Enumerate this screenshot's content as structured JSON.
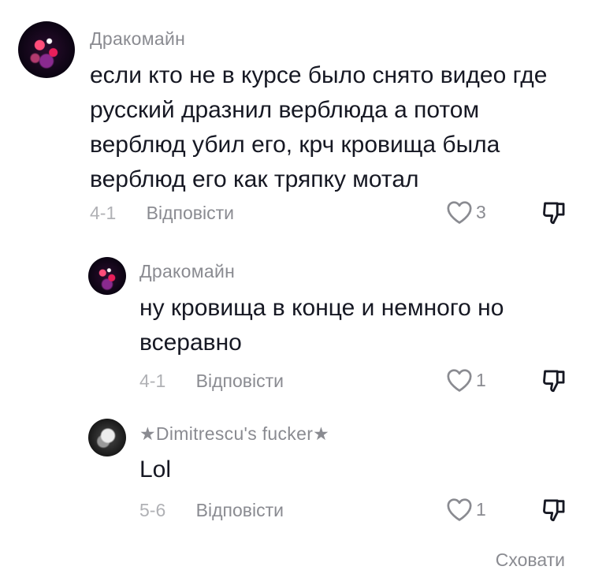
{
  "comments": [
    {
      "username": "Дракомайн",
      "text": "если кто не в курсе было снято видео где\nрусский дразнил верблюда а потом\nверблюд убил его, крч кровища была\nверблюд его как тряпку мотал",
      "date": "4-1",
      "reply_label": "Відповісти",
      "likes": "3",
      "avatar_icon": "user-avatar-icon"
    }
  ],
  "replies": [
    {
      "username": "Дракомайн",
      "text": "ну кровища в конце и немного но\nвсеравно",
      "date": "4-1",
      "reply_label": "Відповісти",
      "likes": "1",
      "avatar_icon": "user-avatar-icon"
    },
    {
      "username": "★Dimitrescu's fucker★",
      "text": "Lol",
      "date": "5-6",
      "reply_label": "Відповісти",
      "likes": "1",
      "avatar_icon": "user-avatar-icon"
    }
  ],
  "hide_label": "Сховати",
  "icons": {
    "like": "heart-icon",
    "dislike": "thumbs-down-icon"
  },
  "colors": {
    "text": "#161823",
    "secondary": "#8a8b91",
    "date": "#b0b1b5"
  }
}
